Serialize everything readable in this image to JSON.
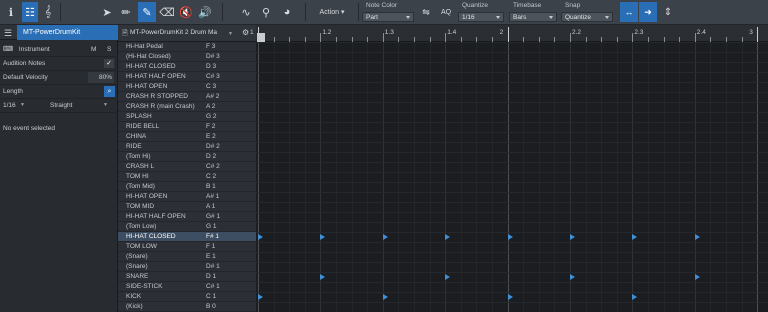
{
  "toolbar": {
    "action_label": "Action",
    "note_color": {
      "label": "Note Color",
      "value": "Part"
    },
    "aq_label": "AQ",
    "quantize": {
      "label": "Quantize",
      "value": "1/16"
    },
    "timebase": {
      "label": "Timebase",
      "value": "Bars"
    },
    "snap": {
      "label": "Snap",
      "value": "Quantize"
    }
  },
  "sidebar": {
    "track_name": "MT-PowerDrumKit",
    "instrument_label": "Instrument",
    "m_label": "M",
    "s_label": "S",
    "audition_label": "Audition Notes",
    "velocity_label": "Default Velocity",
    "velocity_value": "80%",
    "length_label": "Length",
    "length_value": "1/16",
    "straight_value": "Straight",
    "status": "No event selected"
  },
  "keys_header": {
    "title": "MT-PowerDrumKit 2 Drum Ma"
  },
  "keys": [
    {
      "name": "Hi-Hat Pedal",
      "pitch": "F 3"
    },
    {
      "name": "(Hi-Hat Closed)",
      "pitch": "D# 3"
    },
    {
      "name": "HI-HAT CLOSED",
      "pitch": "D 3"
    },
    {
      "name": "HI-HAT HALF OPEN",
      "pitch": "C# 3"
    },
    {
      "name": "HI-HAT OPEN",
      "pitch": "C 3"
    },
    {
      "name": "CRASH R STOPPED",
      "pitch": "A# 2"
    },
    {
      "name": "CRASH R (main Crash)",
      "pitch": "A 2"
    },
    {
      "name": "SPLASH",
      "pitch": "G 2"
    },
    {
      "name": "RIDE BELL",
      "pitch": "F 2"
    },
    {
      "name": "CHINA",
      "pitch": "E 2"
    },
    {
      "name": "RIDE",
      "pitch": "D# 2"
    },
    {
      "name": "(Tom Hi)",
      "pitch": "D 2"
    },
    {
      "name": "CRASH L",
      "pitch": "C# 2"
    },
    {
      "name": "TOM HI",
      "pitch": "C 2"
    },
    {
      "name": "(Tom Mid)",
      "pitch": "B 1"
    },
    {
      "name": "HI-HAT OPEN",
      "pitch": "A# 1"
    },
    {
      "name": "TOM MID",
      "pitch": "A 1"
    },
    {
      "name": "HI-HAT HALF OPEN",
      "pitch": "G# 1"
    },
    {
      "name": "(Tom Low)",
      "pitch": "G 1"
    },
    {
      "name": "HI-HAT CLOSED",
      "pitch": "F# 1"
    },
    {
      "name": "TOM LOW",
      "pitch": "F 1"
    },
    {
      "name": "(Snare)",
      "pitch": "E 1"
    },
    {
      "name": "(Snare)",
      "pitch": "D# 1"
    },
    {
      "name": "SNARE",
      "pitch": "D 1"
    },
    {
      "name": "SIDE-STICK",
      "pitch": "C# 1"
    },
    {
      "name": "KICK",
      "pitch": "C 1"
    },
    {
      "name": "(Kick)",
      "pitch": "B 0"
    }
  ],
  "ruler": {
    "labels": [
      "1",
      "1.2",
      "1.3",
      "1.4",
      "2",
      "2.2",
      "2.3",
      "2.4",
      "3"
    ]
  },
  "notes": [
    {
      "key": 19,
      "steps": [
        0,
        4,
        8,
        12,
        16,
        20,
        24,
        28
      ]
    },
    {
      "key": 23,
      "steps": [
        4,
        12,
        20,
        28
      ]
    },
    {
      "key": 25,
      "steps": [
        0,
        8,
        16,
        24
      ]
    }
  ],
  "colors": {
    "accent": "#2a6fb6",
    "note": "#3f8fd6"
  }
}
